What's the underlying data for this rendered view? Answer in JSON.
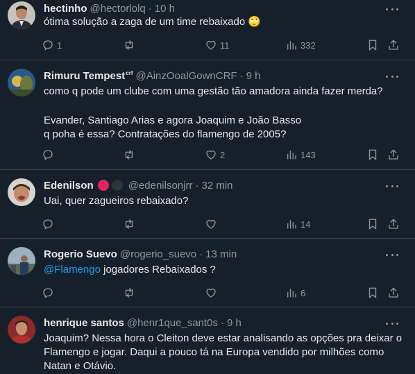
{
  "tweets": [
    {
      "name": "hectinho",
      "handle": "@hectorlolq",
      "time": "10 h",
      "text": "ótima solução a zaga de um time rebaixado 🙄",
      "replies": "1",
      "retweets": "",
      "likes": "11",
      "views": "332"
    },
    {
      "name": "Rimuru Tempest",
      "name_sup": "crf",
      "handle": "@AinzOoalGownCRF",
      "time": "9 h",
      "text_lines": [
        "como q pode um clube com uma gestão tão amadora ainda fazer merda?",
        "",
        "Evander, Santiago Arias e agora Joaquim e João Basso",
        "q poha é essa? Contratações do flamengo de 2005?"
      ],
      "replies": "",
      "retweets": "",
      "likes": "2",
      "views": "143"
    },
    {
      "name": "Edenilson",
      "handle": "@edenilsonjrr",
      "time": "32 min",
      "text": "Uai, quer zagueiros rebaixado?",
      "replies": "",
      "retweets": "",
      "likes": "",
      "views": "14",
      "badges": [
        "#e0245e",
        "#2f3336"
      ]
    },
    {
      "name": "Rogerio Suevo",
      "handle": "@rogerio_suevo",
      "time": "13 min",
      "mention": "@Flamengo",
      "text": " jogadores Rebaixados ?",
      "replies": "",
      "retweets": "",
      "likes": "",
      "views": "6"
    },
    {
      "name": "henrique santos",
      "handle": "@henr1que_sant0s",
      "time": "9 h",
      "text_lines": [
        "Joaquim? Nessa hora o Cleiton deve estar analisando as opções pra deixar o",
        "Flamengo e jogar. Daqui a pouco tá na Europa vendido por milhões como",
        "Natan e Otávio."
      ]
    }
  ],
  "icons": [
    "reply-icon",
    "retweet-icon",
    "like-icon",
    "views-icon",
    "bookmark-icon",
    "share-icon",
    "more-icon"
  ],
  "colors": {
    "background": "#15202b",
    "text": "#e7e9ea",
    "muted": "#8b98a5",
    "accent": "#1d9bf0",
    "divider": "#38444d"
  }
}
